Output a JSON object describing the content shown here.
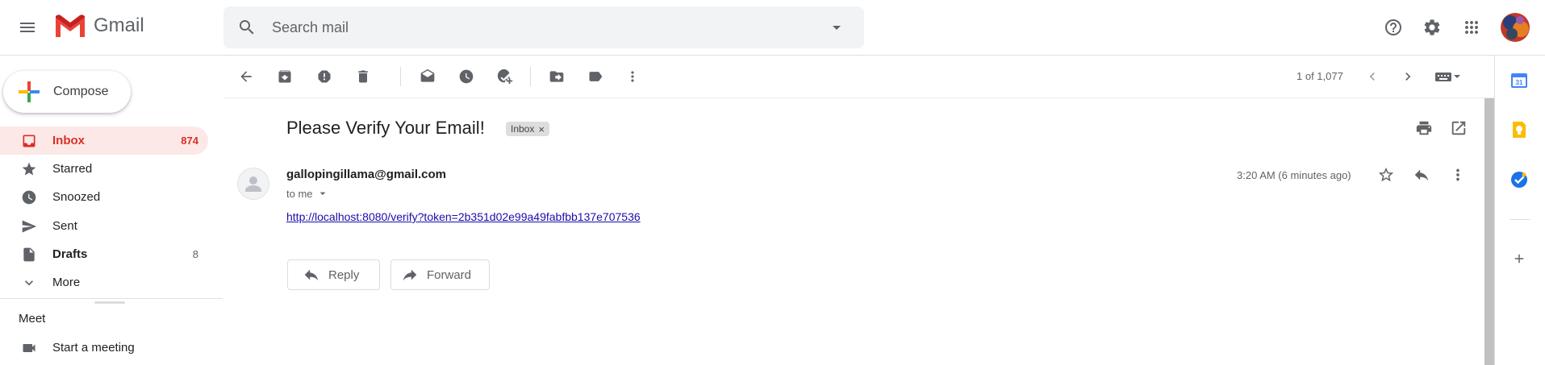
{
  "header": {
    "app_name": "Gmail",
    "search_placeholder": "Search mail"
  },
  "sidebar": {
    "compose_label": "Compose",
    "items": [
      {
        "label": "Inbox",
        "count": "874",
        "icon": "inbox-icon"
      },
      {
        "label": "Starred",
        "count": "",
        "icon": "star-icon"
      },
      {
        "label": "Snoozed",
        "count": "",
        "icon": "clock-icon"
      },
      {
        "label": "Sent",
        "count": "",
        "icon": "send-icon"
      },
      {
        "label": "Drafts",
        "count": "8",
        "icon": "draft-icon"
      },
      {
        "label": "More",
        "count": "",
        "icon": "chevron-down-icon"
      }
    ],
    "meet": {
      "title": "Meet",
      "start_label": "Start a meeting"
    }
  },
  "toolbar": {
    "pager": "1 of 1,077"
  },
  "message": {
    "subject": "Please Verify Your Email!",
    "label_chip": "Inbox",
    "label_chip_close": "×",
    "sender": "gallopingillama@gmail.com",
    "to": "to me",
    "timestamp": "3:20 AM (6 minutes ago)",
    "link": "http://localhost:8080/verify?token=2b351d02e99a49fabfbb137e707536",
    "reply_label": "Reply",
    "forward_label": "Forward"
  },
  "colors": {
    "accent": "#d93025",
    "inbox_bg": "#fce8e6",
    "link": "#1a0dab"
  }
}
